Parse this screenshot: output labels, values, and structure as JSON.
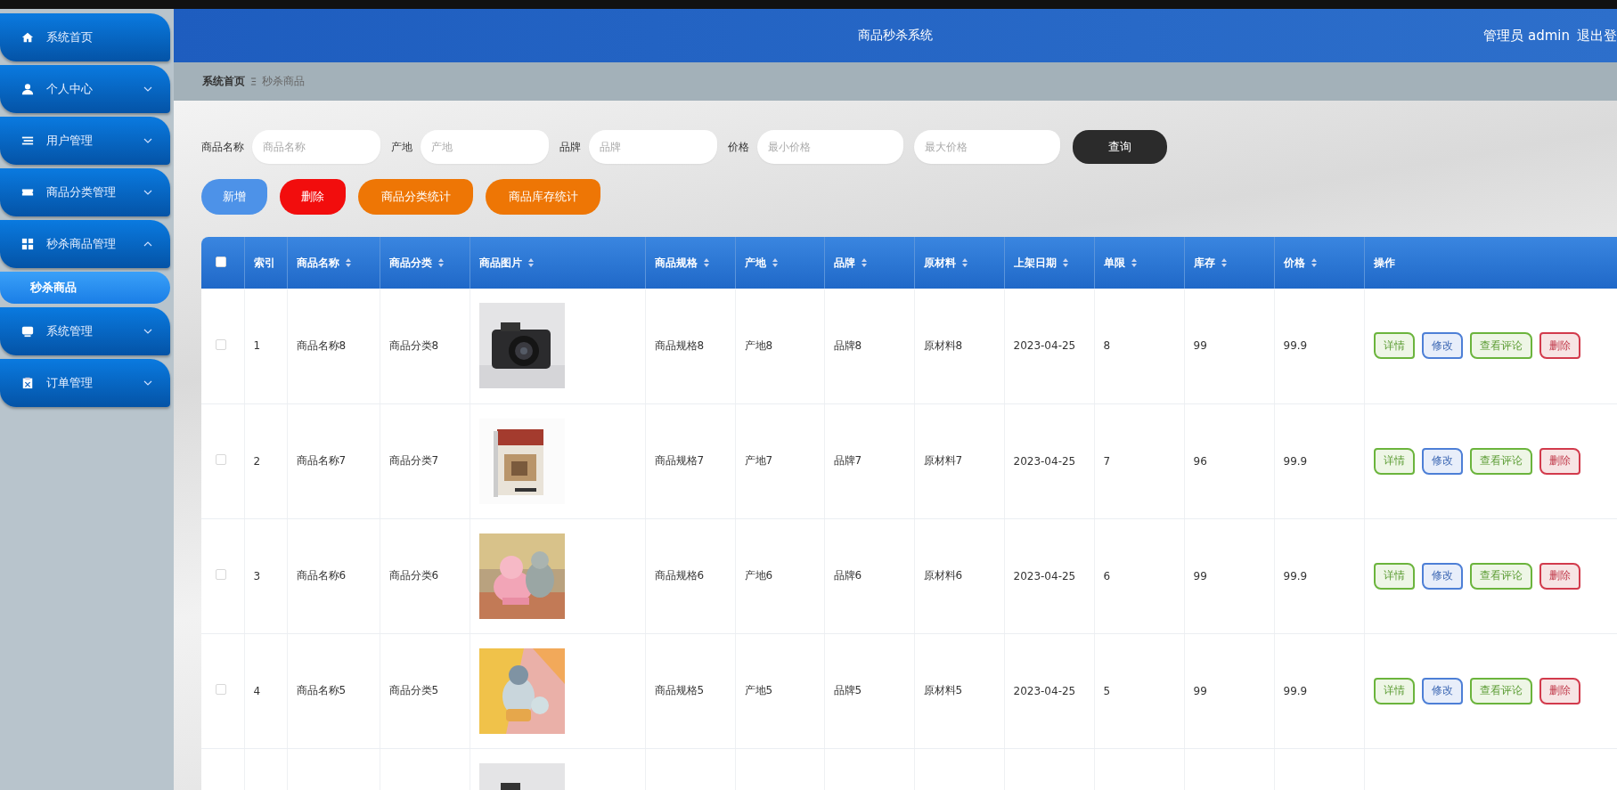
{
  "sidebar": {
    "items": [
      {
        "label": "系统首页"
      },
      {
        "label": "个人中心",
        "expanded": false
      },
      {
        "label": "用户管理",
        "expanded": false
      },
      {
        "label": "商品分类管理",
        "expanded": false
      },
      {
        "label": "秒杀商品管理",
        "expanded": true,
        "children": [
          {
            "label": "秒杀商品",
            "selected": true
          }
        ]
      },
      {
        "label": "系统管理",
        "expanded": false
      },
      {
        "label": "订单管理",
        "expanded": false
      }
    ]
  },
  "header": {
    "title": "商品秒杀系统",
    "user": "管理员 admin",
    "logout": "退出登"
  },
  "breadcrumb": [
    "系统首页",
    "秒杀商品"
  ],
  "search": {
    "fields": [
      {
        "label": "商品名称",
        "placeholder": "商品名称"
      },
      {
        "label": "产地",
        "placeholder": "产地"
      },
      {
        "label": "品牌",
        "placeholder": "品牌"
      },
      {
        "label": "价格",
        "placeholder": "最小价格"
      },
      {
        "placeholder": "最大价格"
      }
    ],
    "button": "查询"
  },
  "actions": [
    {
      "label": "新增",
      "kind": "add"
    },
    {
      "label": "删除",
      "kind": "delete"
    },
    {
      "label": "商品分类统计",
      "kind": "stat"
    },
    {
      "label": "商品库存统计",
      "kind": "stat"
    }
  ],
  "table": {
    "select_all": {
      "checked": false
    },
    "columns": [
      {
        "label": "索引",
        "sortable": false
      },
      {
        "label": "商品名称",
        "sortable": true
      },
      {
        "label": "商品分类",
        "sortable": true
      },
      {
        "label": "商品图片",
        "sortable": true
      },
      {
        "label": "商品规格",
        "sortable": true
      },
      {
        "label": "产地",
        "sortable": true
      },
      {
        "label": "品牌",
        "sortable": true
      },
      {
        "label": "原材料",
        "sortable": true
      },
      {
        "label": "上架日期",
        "sortable": true
      },
      {
        "label": "单限",
        "sortable": true
      },
      {
        "label": "库存",
        "sortable": true
      },
      {
        "label": "价格",
        "sortable": true
      },
      {
        "label": "操作",
        "sortable": false
      }
    ],
    "rows": [
      {
        "checked": false,
        "cells": [
          "1",
          "商品名称8",
          "商品分类8",
          null,
          "商品规格8",
          "产地8",
          "品牌8",
          "原材料8",
          "2023-04-25",
          "8",
          "99",
          "99.9"
        ],
        "operations": [
          {
            "label": "详情",
            "kind": "detail"
          },
          {
            "label": "修改",
            "kind": "edit"
          },
          {
            "label": "查看评论",
            "kind": "detail"
          },
          {
            "label": "删除",
            "kind": "delete"
          }
        ]
      },
      {
        "checked": false,
        "cells": [
          "2",
          "商品名称7",
          "商品分类7",
          null,
          "商品规格7",
          "产地7",
          "品牌7",
          "原材料7",
          "2023-04-25",
          "7",
          "96",
          "99.9"
        ],
        "operations": [
          {
            "label": "详情",
            "kind": "detail"
          },
          {
            "label": "修改",
            "kind": "edit"
          },
          {
            "label": "查看评论",
            "kind": "detail"
          },
          {
            "label": "删除",
            "kind": "delete"
          }
        ]
      },
      {
        "checked": false,
        "cells": [
          "3",
          "商品名称6",
          "商品分类6",
          null,
          "商品规格6",
          "产地6",
          "品牌6",
          "原材料6",
          "2023-04-25",
          "6",
          "99",
          "99.9"
        ],
        "operations": [
          {
            "label": "详情",
            "kind": "detail"
          },
          {
            "label": "修改",
            "kind": "edit"
          },
          {
            "label": "查看评论",
            "kind": "detail"
          },
          {
            "label": "删除",
            "kind": "delete"
          }
        ]
      },
      {
        "checked": false,
        "cells": [
          "4",
          "商品名称5",
          "商品分类5",
          null,
          "商品规格5",
          "产地5",
          "品牌5",
          "原材料5",
          "2023-04-25",
          "5",
          "99",
          "99.9"
        ],
        "operations": [
          {
            "label": "详情",
            "kind": "detail"
          },
          {
            "label": "修改",
            "kind": "edit"
          },
          {
            "label": "查看评论",
            "kind": "detail"
          },
          {
            "label": "删除",
            "kind": "delete"
          }
        ]
      },
      {
        "cells": [
          null,
          null,
          null,
          null,
          null,
          null,
          null,
          null,
          null,
          null,
          null,
          null
        ]
      }
    ]
  }
}
